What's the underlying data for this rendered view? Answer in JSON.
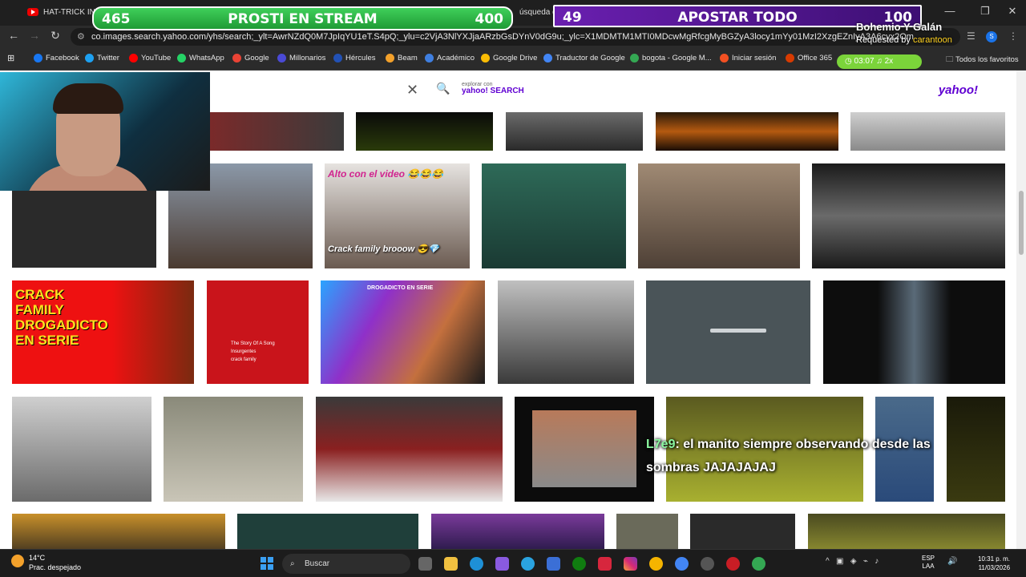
{
  "tabs": [
    {
      "label": "HAT-TRICK INOU",
      "icon": "youtube-icon"
    }
  ],
  "tab_fragment": "úsqueda de",
  "omnibox": {
    "url": "co.images.search.yahoo.com/yhs/search;_ylt=AwrNZdQ0M7JpIqYU1eT.S4pQ;_ylu=c2VjA3NlYXJjaARzbGsDYnV0dG9u;_ylc=X1MDMTM1MTI0MDcwMgRfcgMyBGZyA3locy1mYy01MzI2XzgEZnIyA3A6cyx2Om"
  },
  "bookmarks": [
    {
      "label": "Facebook",
      "color": "#1877f2"
    },
    {
      "label": "Twitter",
      "color": "#1da1f2"
    },
    {
      "label": "YouTube",
      "color": "#ff0000"
    },
    {
      "label": "WhatsApp",
      "color": "#25d366"
    },
    {
      "label": "Google",
      "color": "#ea4335"
    },
    {
      "label": "Millonarios",
      "color": "#4a4ad6"
    },
    {
      "label": "Hércules",
      "color": "#2251b5"
    },
    {
      "label": "Beam",
      "color": "#f3a12b"
    },
    {
      "label": "Académico",
      "color": "#3f7fe0"
    },
    {
      "label": "Google Drive",
      "color": "#fbbc04"
    },
    {
      "label": "Traductor de Google",
      "color": "#4285f4"
    },
    {
      "label": "bogota - Google M...",
      "color": "#34a853"
    },
    {
      "label": "Iniciar sesión",
      "color": "#f25022"
    },
    {
      "label": "Office 365",
      "color": "#d83b01"
    }
  ],
  "all_favorites": "Todos los favoritos",
  "overlay": {
    "green": {
      "left": "465",
      "center": "PROSTI EN STREAM",
      "right": "400"
    },
    "purple": {
      "left": "49",
      "center": "APOSTAR TODO",
      "right": "100"
    },
    "song_title": "Bohemio Y Galán",
    "song_requested_prefix": "Requested by ",
    "song_requested_by": "carantoon",
    "song_time": "03:07",
    "song_speed": "2x"
  },
  "search": {
    "explore_label": "explorar con",
    "explore_brand": "yahoo! SEARCH",
    "logo": "yahoo!"
  },
  "thumb_texts": {
    "alto": "Alto con el video 😂😂😂",
    "crackfam": "Crack family brooow 😎💎",
    "drog_title": "CRACK FAMILY DROGADICTO EN SERIE",
    "story": "The Story Of A Song",
    "story2": "Insurgentes",
    "story3": "crack family",
    "drog2": "DROGADICTO EN SERIE"
  },
  "chat": {
    "user": "L7e9",
    "message": ": el manito siempre observando desde las sombras JAJAJAJAJ"
  },
  "taskbar": {
    "weather_temp": "14°C",
    "weather_desc": "Prac. despejado",
    "search_label": "Buscar",
    "lang1": "ESP",
    "lang2": "LAA",
    "time": "10:31 p. m.",
    "date": "11/03/2026"
  }
}
